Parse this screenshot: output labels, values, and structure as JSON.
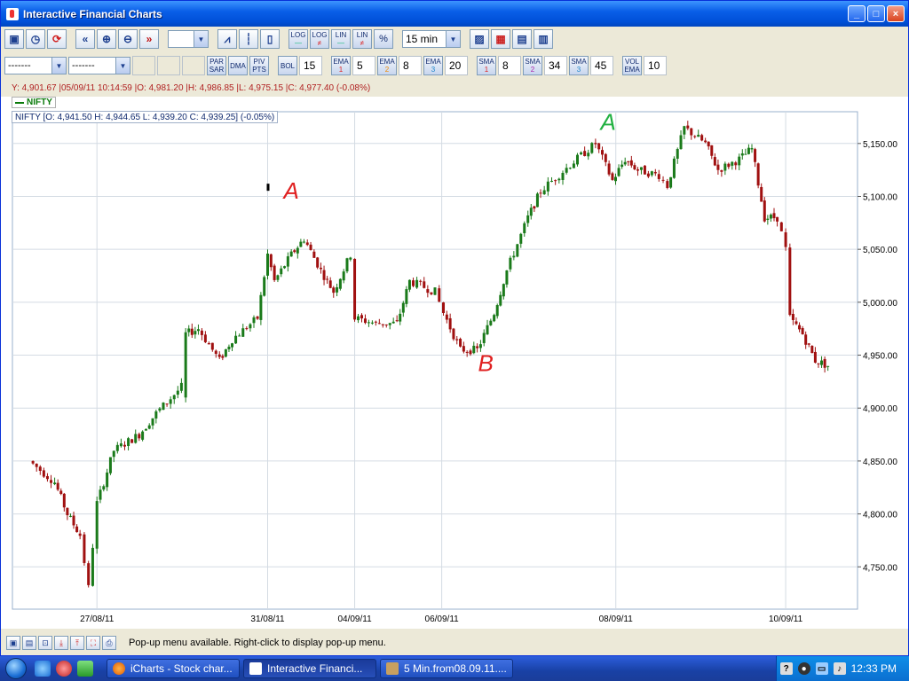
{
  "window": {
    "title": "Interactive Financial Charts"
  },
  "toolbar1": {
    "interval": "15 min",
    "log_label": "LOG",
    "log2_label": "LOG",
    "lin_label": "LIN",
    "lin2_label": "LIN",
    "pct_label": "%"
  },
  "toolbar2": {
    "combo1": "-------",
    "combo2": "-------",
    "par_sar": "PAR SAR",
    "dma": "DMA",
    "piv_pts": "PIV PTS",
    "bol": "BOL",
    "bol_val": "15",
    "ema1": "EMA",
    "ema1_idx": "1",
    "ema1_val": "5",
    "ema2": "EMA",
    "ema2_idx": "2",
    "ema2_val": "8",
    "ema3": "EMA",
    "ema3_idx": "3",
    "ema3_val": "20",
    "sma1": "SMA",
    "sma1_idx": "1",
    "sma1_val": "8",
    "sma2": "SMA",
    "sma2_idx": "2",
    "sma2_val": "34",
    "sma3": "SMA",
    "sma3_idx": "3",
    "sma3_val": "45",
    "vol_ema": "VOL EMA",
    "vol_ema_val": "10"
  },
  "info_line": "Y: 4,901.67 |05/09/11 10:14:59 |O: 4,981.20 |H: 4,986.85 |L: 4,975.15 |C: 4,977.40 (-0.08%)",
  "legend": "NIFTY",
  "ohlc_box": "NIFTY [O: 4,941.50  H: 4,944.65  L: 4,939.20  C: 4,939.25] (-0.05%)",
  "status": {
    "message": "Pop-up menu available. Right-click to display pop-up menu."
  },
  "taskbar": {
    "tasks": [
      "iCharts - Stock char...",
      "Interactive Financi...",
      "5 Min.from08.09.11...."
    ],
    "clock": "12:33 PM"
  },
  "chart_data": {
    "type": "candlestick",
    "ylim": [
      4710,
      5180
    ],
    "yticks": [
      "5,150.00",
      "5,100.00",
      "5,050.00",
      "5,000.00",
      "4,950.00",
      "4,900.00",
      "4,850.00",
      "4,800.00",
      "4,750.00"
    ],
    "ytick_values": [
      5150,
      5100,
      5050,
      5000,
      4950,
      4900,
      4850,
      4800,
      4750
    ],
    "xticks": [
      "27/08/11",
      "31/08/11",
      "04/09/11",
      "06/09/11",
      "08/09/11",
      "10/09/11"
    ],
    "xtick_positions": [
      0.1,
      0.302,
      0.405,
      0.508,
      0.714,
      0.915
    ],
    "annotations": [
      {
        "text": "A",
        "color": "#e02020",
        "price": 5098,
        "at": 0.33
      },
      {
        "text": "B",
        "color": "#e02020",
        "price": 4935,
        "at": 0.56
      },
      {
        "text": "A",
        "color": "#20b040",
        "price": 5163,
        "at": 0.705
      }
    ],
    "keypoints": [
      [
        0.02,
        4850
      ],
      [
        0.05,
        4830
      ],
      [
        0.065,
        4800
      ],
      [
        0.08,
        4780
      ],
      [
        0.09,
        4730
      ],
      [
        0.1,
        4810
      ],
      [
        0.12,
        4860
      ],
      [
        0.15,
        4875
      ],
      [
        0.17,
        4895
      ],
      [
        0.2,
        4920
      ],
      [
        0.2,
        4910
      ],
      [
        0.205,
        4970
      ],
      [
        0.22,
        4975
      ],
      [
        0.245,
        4945
      ],
      [
        0.26,
        4965
      ],
      [
        0.29,
        4985
      ],
      [
        0.302,
        5045
      ],
      [
        0.31,
        5020
      ],
      [
        0.33,
        5045
      ],
      [
        0.345,
        5060
      ],
      [
        0.365,
        5030
      ],
      [
        0.38,
        5010
      ],
      [
        0.4,
        5045
      ],
      [
        0.405,
        4985
      ],
      [
        0.43,
        4980
      ],
      [
        0.455,
        4980
      ],
      [
        0.47,
        5020
      ],
      [
        0.5,
        5010
      ],
      [
        0.51,
        4990
      ],
      [
        0.53,
        4955
      ],
      [
        0.55,
        4955
      ],
      [
        0.57,
        4990
      ],
      [
        0.585,
        5030
      ],
      [
        0.61,
        5080
      ],
      [
        0.625,
        5105
      ],
      [
        0.66,
        5130
      ],
      [
        0.69,
        5150
      ],
      [
        0.71,
        5115
      ],
      [
        0.725,
        5135
      ],
      [
        0.74,
        5125
      ],
      [
        0.765,
        5120
      ],
      [
        0.775,
        5110
      ],
      [
        0.795,
        5165
      ],
      [
        0.82,
        5150
      ],
      [
        0.835,
        5125
      ],
      [
        0.86,
        5135
      ],
      [
        0.875,
        5145
      ],
      [
        0.89,
        5080
      ],
      [
        0.905,
        5080
      ],
      [
        0.915,
        5050
      ],
      [
        0.92,
        4985
      ],
      [
        0.935,
        4970
      ],
      [
        0.95,
        4945
      ],
      [
        0.965,
        4940
      ]
    ],
    "gap_after": [
      0.4,
      0.915
    ],
    "bull_color": "#1a7a1a",
    "bear_color": "#a01010",
    "grid": true
  }
}
